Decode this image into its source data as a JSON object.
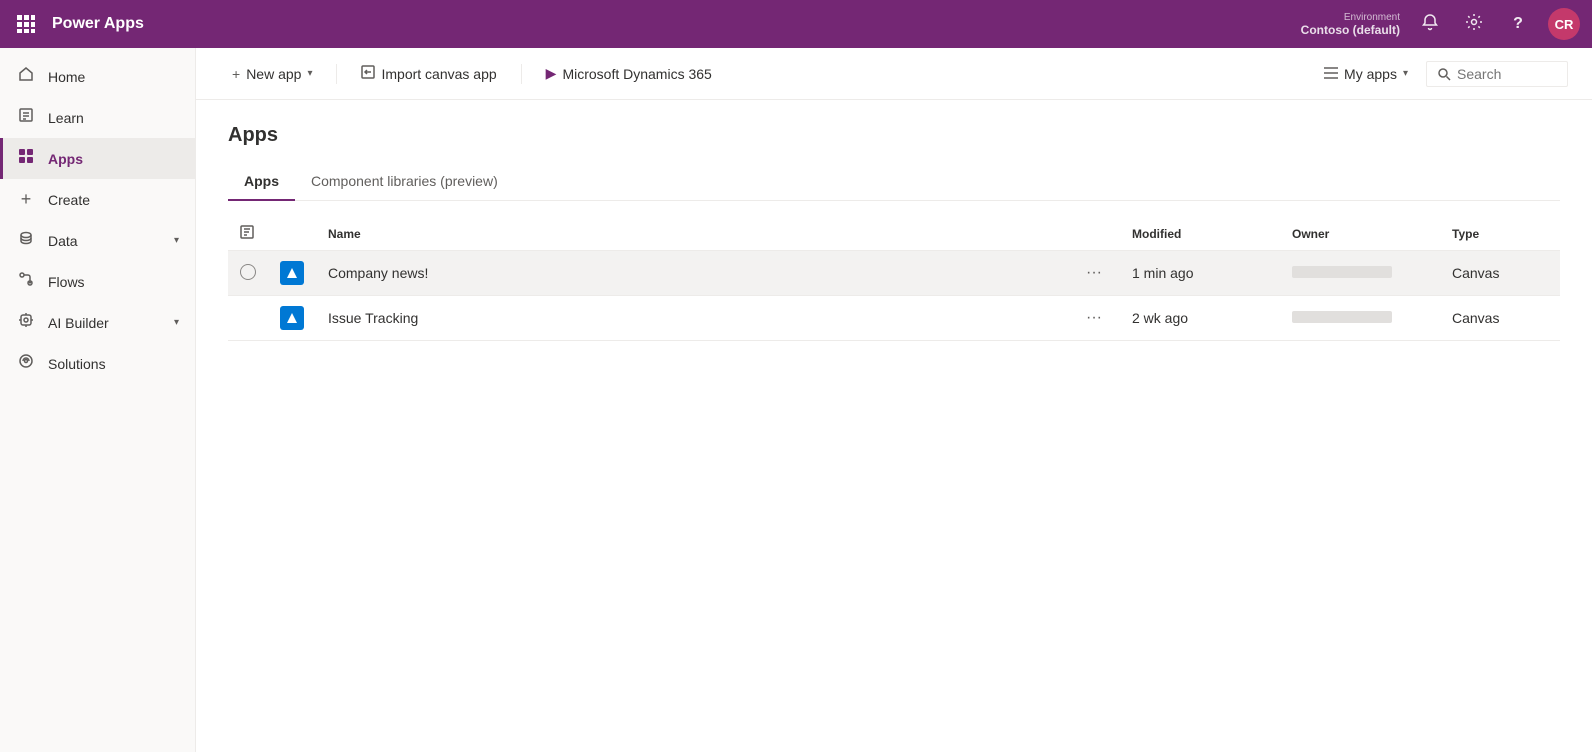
{
  "topbar": {
    "title": "Power Apps",
    "waffle_icon": "⊞",
    "environment_label": "Environment",
    "environment_name": "Contoso (default)",
    "bell_icon": "🔔",
    "settings_icon": "⚙",
    "help_icon": "?",
    "avatar_initials": "CR"
  },
  "sidebar": {
    "toggle_icon": "☰",
    "items": [
      {
        "id": "home",
        "label": "Home",
        "icon": "⌂"
      },
      {
        "id": "learn",
        "label": "Learn",
        "icon": "📖"
      },
      {
        "id": "apps",
        "label": "Apps",
        "icon": "⊞",
        "active": true
      },
      {
        "id": "create",
        "label": "Create",
        "icon": "+"
      },
      {
        "id": "data",
        "label": "Data",
        "icon": "🗄",
        "has_chevron": true
      },
      {
        "id": "flows",
        "label": "Flows",
        "icon": "↻"
      },
      {
        "id": "ai-builder",
        "label": "AI Builder",
        "icon": "🤖",
        "has_chevron": true
      },
      {
        "id": "solutions",
        "label": "Solutions",
        "icon": "🧩"
      }
    ]
  },
  "toolbar": {
    "new_app_label": "New app",
    "new_app_icon": "+",
    "new_app_chevron": "▾",
    "import_label": "Import canvas app",
    "import_icon": "⬅",
    "dynamics_label": "Microsoft Dynamics 365",
    "dynamics_icon": "▶",
    "my_apps_label": "My apps",
    "my_apps_icon": "≡",
    "my_apps_chevron": "▾",
    "search_placeholder": "Search"
  },
  "page": {
    "title": "Apps",
    "tabs": [
      {
        "id": "apps",
        "label": "Apps",
        "active": true
      },
      {
        "id": "component-libraries",
        "label": "Component libraries (preview)",
        "active": false
      }
    ],
    "table": {
      "columns": [
        {
          "id": "check",
          "label": ""
        },
        {
          "id": "icon",
          "label": ""
        },
        {
          "id": "name",
          "label": "Name"
        },
        {
          "id": "more",
          "label": ""
        },
        {
          "id": "modified",
          "label": "Modified"
        },
        {
          "id": "owner",
          "label": "Owner"
        },
        {
          "id": "type",
          "label": "Type"
        }
      ],
      "rows": [
        {
          "id": "company-news",
          "name": "Company news!",
          "modified": "1 min ago",
          "type": "Canvas",
          "highlighted": true
        },
        {
          "id": "issue-tracking",
          "name": "Issue Tracking",
          "modified": "2 wk ago",
          "type": "Canvas",
          "highlighted": false
        }
      ]
    }
  }
}
